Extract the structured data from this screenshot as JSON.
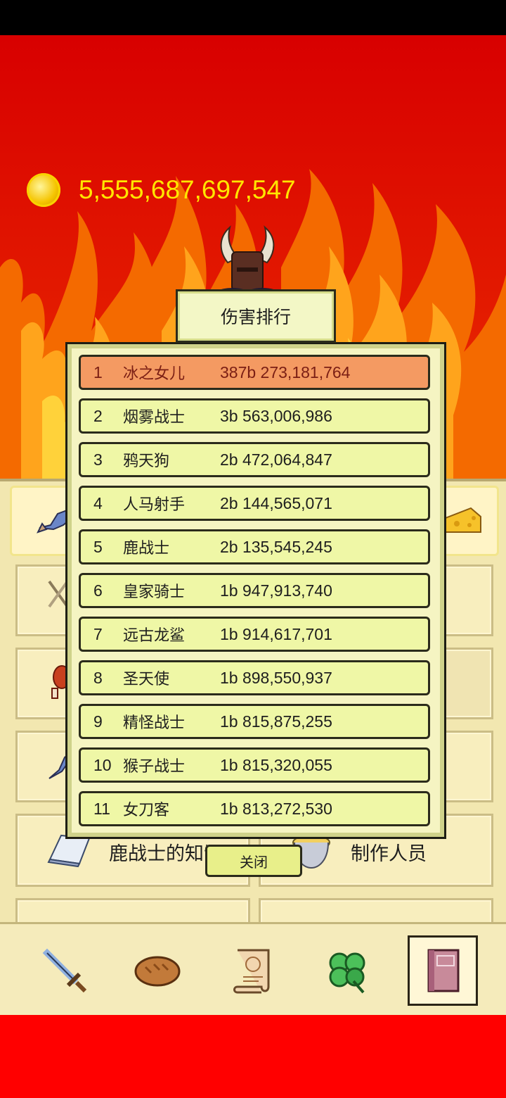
{
  "currency": {
    "icon": "gold-coin-icon",
    "amount": "5,555,687,697,547"
  },
  "modal": {
    "title": "伤害排行",
    "rows": [
      {
        "rank": "1",
        "name": "冰之女儿",
        "damage": "387b 273,181,764"
      },
      {
        "rank": "2",
        "name": "烟雾战士",
        "damage": "3b 563,006,986"
      },
      {
        "rank": "3",
        "name": "鸦天狗",
        "damage": "2b 472,064,847"
      },
      {
        "rank": "4",
        "name": "人马射手",
        "damage": "2b 144,565,071"
      },
      {
        "rank": "5",
        "name": "鹿战士",
        "damage": "2b 135,545,245"
      },
      {
        "rank": "6",
        "name": "皇家骑士",
        "damage": "1b 947,913,740"
      },
      {
        "rank": "7",
        "name": "远古龙鲨",
        "damage": "1b 914,617,701"
      },
      {
        "rank": "8",
        "name": "圣天使",
        "damage": "1b 898,550,937"
      },
      {
        "rank": "9",
        "name": "精怪战士",
        "damage": "1b 815,875,255"
      },
      {
        "rank": "10",
        "name": "猴子战士",
        "damage": "1b 815,320,055"
      },
      {
        "rank": "11",
        "name": "女刀客",
        "damage": "1b 813,272,530"
      }
    ],
    "close_label": "关闭"
  },
  "menu": {
    "left_label": "鹿战士的知识",
    "right_label": "制作人员"
  },
  "bottom_nav": [
    "sword-icon",
    "bread-icon",
    "scroll-icon",
    "clover-icon",
    "book-icon"
  ],
  "colors": {
    "background_red": "#e00000",
    "coin_text": "#ffe600",
    "highlight_row": "#f49a62",
    "row": "#eff7a6"
  }
}
